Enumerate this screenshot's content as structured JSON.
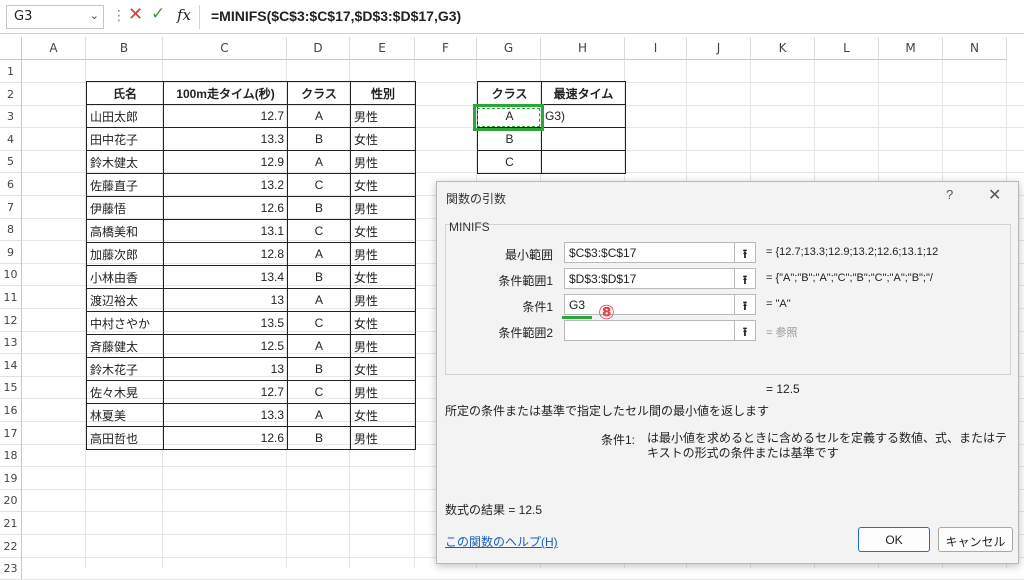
{
  "formula_bar": {
    "name_box": "G3",
    "formula": "=MINIFS($C$3:$C$17,$D$3:$D$17,G3)",
    "fx_label": "fx"
  },
  "columns": [
    "A",
    "B",
    "C",
    "D",
    "E",
    "F",
    "G",
    "H",
    "I",
    "J",
    "K",
    "L",
    "M",
    "N"
  ],
  "rows": [
    "1",
    "2",
    "3",
    "4",
    "5",
    "6",
    "7",
    "8",
    "9",
    "10",
    "11",
    "12",
    "13",
    "14",
    "15",
    "16",
    "17",
    "18",
    "19",
    "20",
    "21",
    "22",
    "23"
  ],
  "main_table": {
    "headers": [
      "氏名",
      "100m走タイム(秒)",
      "クラス",
      "性別"
    ],
    "rows": [
      [
        "山田太郎",
        "12.7",
        "A",
        "男性"
      ],
      [
        "田中花子",
        "13.3",
        "B",
        "女性"
      ],
      [
        "鈴木健太",
        "12.9",
        "A",
        "男性"
      ],
      [
        "佐藤直子",
        "13.2",
        "C",
        "女性"
      ],
      [
        "伊藤悟",
        "12.6",
        "B",
        "男性"
      ],
      [
        "高橋美和",
        "13.1",
        "C",
        "女性"
      ],
      [
        "加藤次郎",
        "12.8",
        "A",
        "男性"
      ],
      [
        "小林由香",
        "13.4",
        "B",
        "女性"
      ],
      [
        "渡辺裕太",
        "13",
        "A",
        "男性"
      ],
      [
        "中村さやか",
        "13.5",
        "C",
        "女性"
      ],
      [
        "斉藤健太",
        "12.5",
        "A",
        "男性"
      ],
      [
        "鈴木花子",
        "13",
        "B",
        "女性"
      ],
      [
        "佐々木晃",
        "12.7",
        "C",
        "男性"
      ],
      [
        "林夏美",
        "13.3",
        "A",
        "女性"
      ],
      [
        "高田哲也",
        "12.6",
        "B",
        "男性"
      ]
    ]
  },
  "side_table": {
    "headers": [
      "クラス",
      "最速タイム"
    ],
    "rows": [
      [
        "A",
        "G3)"
      ],
      [
        "B",
        ""
      ],
      [
        "C",
        ""
      ]
    ]
  },
  "dialog": {
    "title": "関数の引数",
    "help_q": "?",
    "close": "✕",
    "function_name": "MINIFS",
    "args": [
      {
        "label": "最小範囲",
        "value": "$C$3:$C$17",
        "result": "=  {12.7;13.3;12.9;13.2;12.6;13.1;12"
      },
      {
        "label": "条件範囲1",
        "value": "$D$3:$D$17",
        "result": "=  {\"A\";\"B\";\"A\";\"C\";\"B\";\"C\";\"A\";\"B\";\"/"
      },
      {
        "label": "条件1",
        "value": "G3",
        "result": "=  \"A\""
      },
      {
        "label": "条件範囲2",
        "value": "",
        "result": "=  参照"
      }
    ],
    "mid_result": "=  12.5",
    "description": "所定の条件または基準で指定したセル間の最小値を返します",
    "param_label": "条件1:",
    "param_desc": "は最小値を求めるときに含めるセルを定義する数値、式、またはテキストの形式の条件または基準です",
    "formula_result": "数式の結果 =   12.5",
    "help_link": "この関数のヘルプ(H)",
    "ok": "OK",
    "cancel": "キャンセル"
  },
  "annotation": "⑧"
}
